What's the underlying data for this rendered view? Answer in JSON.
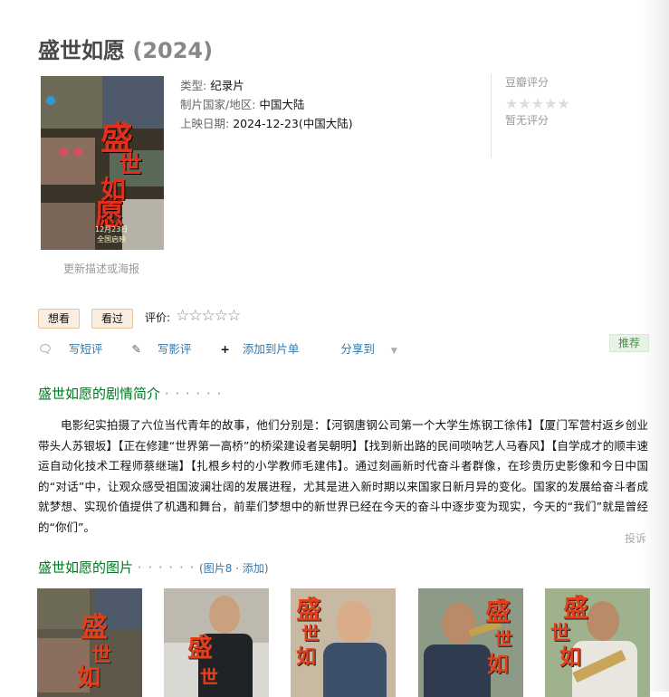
{
  "movie": {
    "name": "盛世如愿",
    "year": "(2024)"
  },
  "poster": {
    "calligraphy": [
      "盛",
      "世",
      "如",
      "愿"
    ],
    "date_line1": "12月23日",
    "date_line2": "全国启映",
    "update_link": "更新描述或海报"
  },
  "info": {
    "genre_key": "类型:",
    "genre_val": "纪录片",
    "region_key": "制片国家/地区:",
    "region_val": "中国大陆",
    "release_key": "上映日期:",
    "release_val": "2024-12-23(中国大陆)"
  },
  "rating": {
    "label": "豆瓣评分",
    "stars": "★★★★★",
    "no_rating": "暂无评分"
  },
  "interest": {
    "want": "想看",
    "seen": "看过",
    "rate_label": "评价:",
    "rate_stars": "☆☆☆☆☆"
  },
  "actions": {
    "short_review": "写短评",
    "review": "写影评",
    "add_list": "添加到片单",
    "share": "分享到",
    "recommend": "推荐"
  },
  "synopsis": {
    "title": "盛世如愿的剧情简介",
    "dots": "· · · · · ·",
    "text": "电影纪实拍摄了六位当代青年的故事，他们分别是：【河钢唐钢公司第一个大学生炼钢工徐伟】【厦门军营村返乡创业带头人苏银坂】【正在修建“世界第一高桥”的桥梁建设者吴朝明】【找到新出路的民间唢呐艺人马春风】【自学成才的顺丰速运自动化技术工程师蔡继瑞】【扎根乡村的小学教师毛建伟】。通过刻画新时代奋斗者群像，在珍贵历史影像和今日中国的“对话”中，让观众感受祖国波澜壮阔的发展进程，尤其是进入新时期以来国家日新月异的变化。国家的发展给奋斗者成就梦想、实现价值提供了机遇和舞台，前辈们梦想中的新世界已经在今天的奋斗中逐步变为现实，今天的“我们”就是曾经的“你们”。",
    "report": "投诉"
  },
  "photos": {
    "title": "盛世如愿的图片",
    "dots": "· · · · · ·",
    "paren_open": "(",
    "count": "图片8",
    "sep": " · ",
    "add": "添加",
    "paren_close": ")"
  },
  "colors": {
    "green_title": "#007722",
    "link_blue": "#3377aa",
    "poster_red": "#e2301d"
  }
}
